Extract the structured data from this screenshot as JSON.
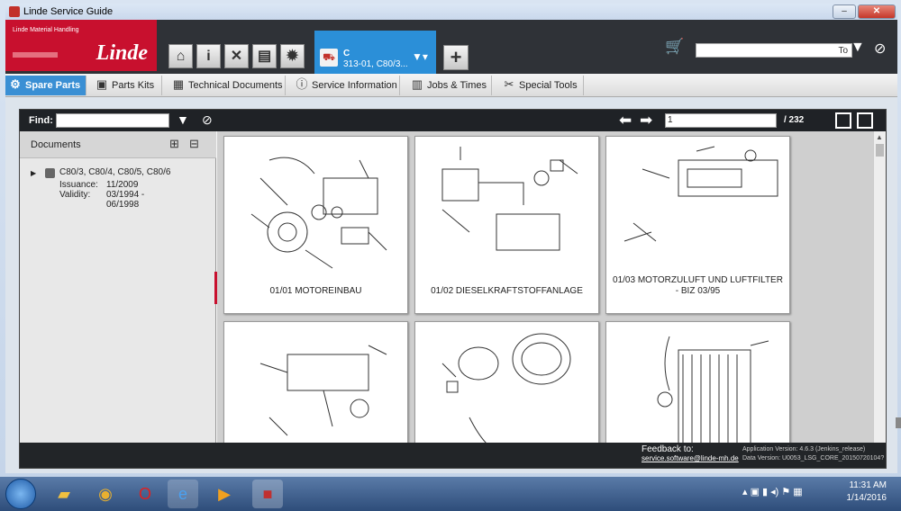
{
  "window": {
    "title": "Linde Service Guide",
    "min": "–",
    "max": "□",
    "close": "✕"
  },
  "header": {
    "logo_sub": "Linde Material Handling",
    "logo_brand": "Linde",
    "nav_icons": [
      "home-icon",
      "info-icon",
      "tools-icon",
      "forklift-icon",
      "gear-icon"
    ],
    "context_tab": {
      "line1": "C",
      "line2": "313-01, C80/3..."
    },
    "add_tab": "+",
    "search_to": "To",
    "search_value": ""
  },
  "menu": {
    "tabs": [
      {
        "label": "Spare Parts",
        "active": true,
        "icon": "spare-parts-icon"
      },
      {
        "label": "Parts Kits",
        "active": false,
        "icon": "parts-kits-icon"
      },
      {
        "label": "Technical Documents",
        "active": false,
        "icon": "technical-documents-icon"
      },
      {
        "label": "Service Information",
        "active": false,
        "icon": "service-information-icon"
      },
      {
        "label": "Jobs & Times",
        "active": false,
        "icon": "jobs-times-icon"
      },
      {
        "label": "Special Tools",
        "active": false,
        "icon": "special-tools-icon"
      }
    ]
  },
  "findbar": {
    "label": "Find:",
    "value": "",
    "page": "1",
    "page_total": "/ 232"
  },
  "documents": {
    "heading": "Documents",
    "item": {
      "name": "C80/3, C80/4, C80/5, C80/6",
      "issuance_label": "Issuance:",
      "issuance": "11/2009",
      "validity_label": "Validity:",
      "validity_1": "03/1994 -",
      "validity_2": "06/1998"
    }
  },
  "thumbnails": [
    {
      "caption": "01/01 MOTOREINBAU"
    },
    {
      "caption": "01/02 DIESELKRAFTSTOFFANLAGE"
    },
    {
      "caption": "01/03 MOTORZULUFT UND LUFTFILTER - BIZ 03/95"
    },
    {
      "caption": ""
    },
    {
      "caption": ""
    },
    {
      "caption": ""
    }
  ],
  "footer": {
    "feedback_label": "Feedback to:",
    "feedback_email": "service.software@linde-mh.de",
    "app_version": "Application Version: 4.6.3 (Jenkins_release)",
    "data_version": "Data Version: U0053_LSG_CORE_20150720104?"
  },
  "taskbar": {
    "time": "11:31 AM",
    "date": "1/14/2016"
  }
}
